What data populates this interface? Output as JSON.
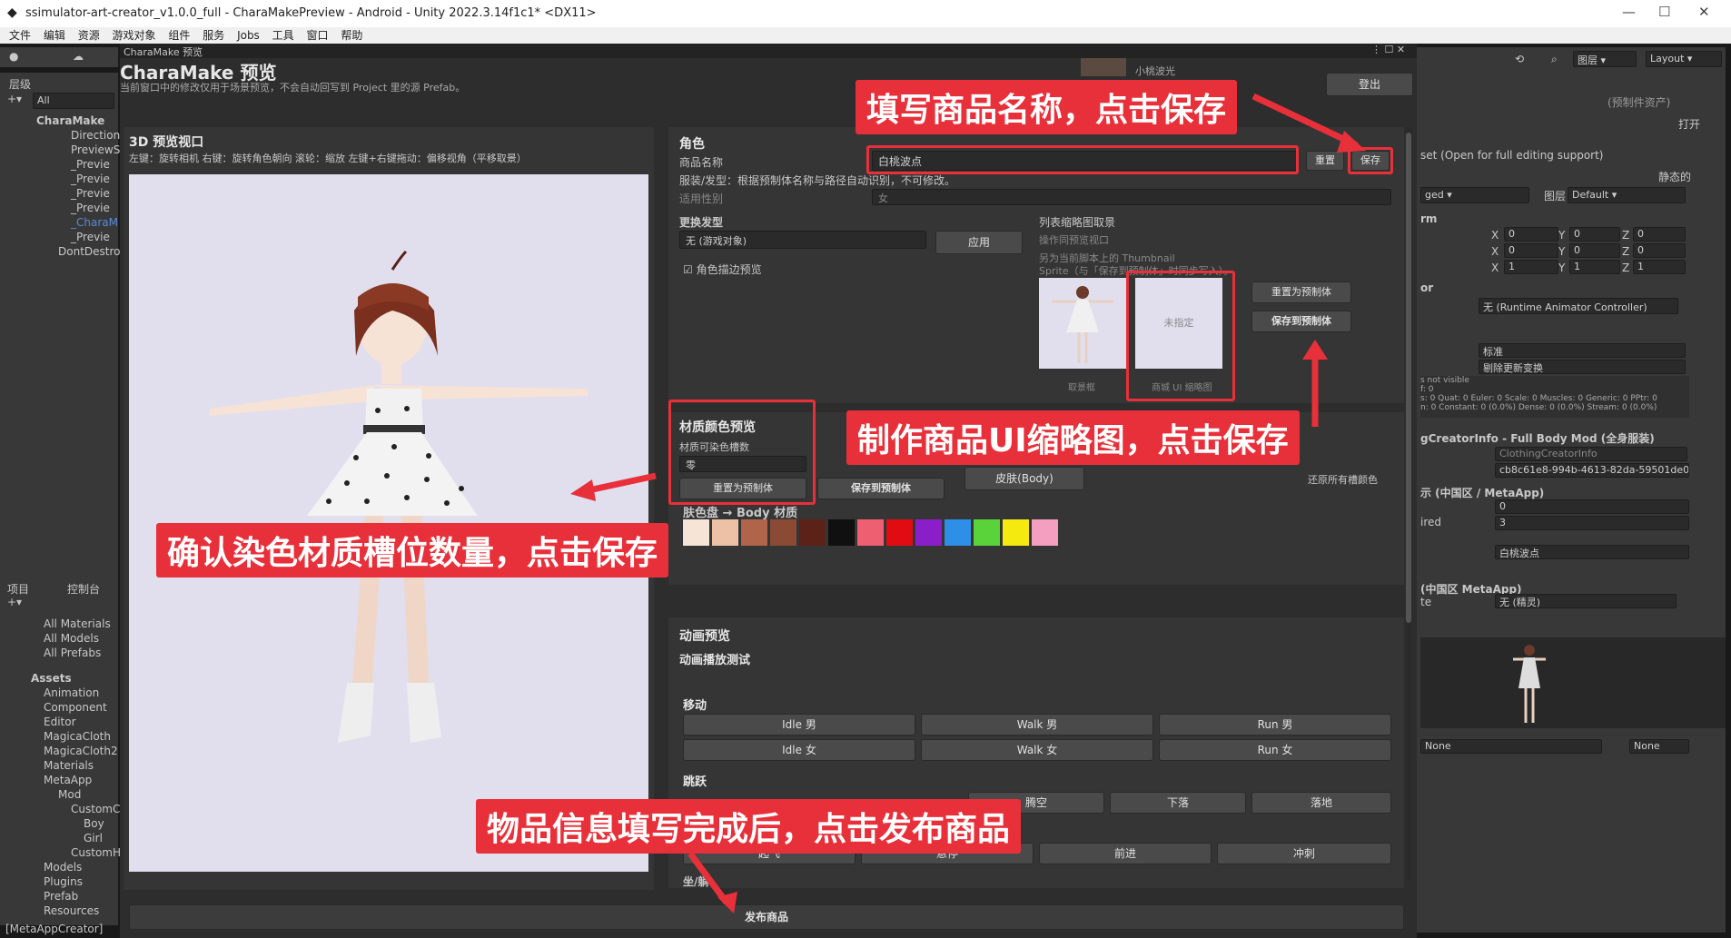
{
  "window": {
    "title": "ssimulator-art-creator_v1.0.0_full - CharaMakePreview - Android - Unity 2022.3.14f1c1* <DX11>"
  },
  "menu": [
    "文件",
    "编辑",
    "资源",
    "游戏对象",
    "组件",
    "服务",
    "Jobs",
    "工具",
    "窗口",
    "帮助"
  ],
  "hierarchy": {
    "tab": "层级",
    "search": "All",
    "items": [
      "CharaMake",
      "Direction",
      "PreviewS",
      "_Previe",
      "_Previe",
      "_Previe",
      "_Previe",
      "_CharaM",
      "_Previe",
      "DontDestro"
    ]
  },
  "project": {
    "tabs": [
      "项目",
      "控制台"
    ],
    "favorites": [
      "All Materials",
      "All Models",
      "All Prefabs"
    ],
    "assets_label": "Assets",
    "folders": [
      "Animation",
      "Component",
      "Editor",
      "MagicaCloth",
      "MagicaCloth2",
      "Materials",
      "MetaApp",
      "Mod",
      "CustomC",
      "Boy",
      "Girl",
      "CustomH",
      "Models",
      "Plugins",
      "Prefab",
      "Resources"
    ],
    "status": "[MetaAppCreator]"
  },
  "modal": {
    "tab": "CharaMake 预览",
    "title": "CharaMake 预览",
    "subtitle": "当前窗口中的修改仅用于场景预览，不会自动回写到 Project 里的源 Prefab。",
    "logout": "登出",
    "user": "小桃波光"
  },
  "viewport": {
    "title": "3D 预览视口",
    "hint": "左键：旋转相机    右键：旋转角色朝向    滚轮：缩放    左键+右键拖动：偏移视角（平移取景）"
  },
  "role": {
    "section": "角色",
    "name_label": "商品名称",
    "name_value": "白桃波点",
    "reset": "重置",
    "save": "保存",
    "desc": "服装/发型：根据预制体名称与路径自动识别，不可修改。",
    "gender_label": "适用性别",
    "gender_value": "女",
    "hair_label": "更换发型",
    "hair_value": "无 (游戏对象)",
    "apply": "应用",
    "outline": "角色描边预览",
    "thumb_title": "列表缩略图取景",
    "thumb_sub": "操作同预览视口",
    "thumb_desc1": "另为当前脚本上的 Thumbnail",
    "thumb_desc2": "Sprite（与「保存到预制体」时同步写入）。",
    "thumb_cap1": "取景框",
    "thumb_cap2": "商城 UI 缩略图",
    "thumb_unset": "未指定",
    "reset_prefab": "重置为预制体",
    "save_prefab": "保存到预制体"
  },
  "material": {
    "section": "材质颜色预览",
    "slots_label": "材质可染色槽数",
    "slots_value": "零",
    "reset_prefab": "重置为预制体",
    "save_prefab": "保存到预制体",
    "skin_tab": "皮肤(Body)",
    "restore": "还原所有槽颜色",
    "palette_label": "肤色盘 → Body 材质",
    "palette": [
      "#f6e4d6",
      "#ecc1a6",
      "#b0644a",
      "#8a4a33",
      "#5c2218",
      "#101010",
      "#ef5f72",
      "#e10b12",
      "#8a1fc9",
      "#2f8ee5",
      "#5ad33a",
      "#f5ea0f",
      "#f59fc0"
    ]
  },
  "anim": {
    "section": "动画预览",
    "sub": "动画播放测试",
    "move": "移动",
    "move_btns": [
      "Idle 男",
      "Walk 男",
      "Run 男",
      "Idle 女",
      "Walk 女",
      "Run 女"
    ],
    "jump": "跳跃",
    "jump_btns": [
      "腾空",
      "下落",
      "落地"
    ],
    "fly_btns": [
      "起飞",
      "悬停",
      "前进",
      "冲刺"
    ],
    "more": "坐/躺"
  },
  "publish": "发布商品",
  "inspector": {
    "layout": "Layout",
    "layers": "图层",
    "prefab_asset": "(预制件资产)",
    "open": "打开",
    "open_note": "set (Open for full editing support)",
    "static": "静态的",
    "tag": "ged",
    "layer_label": "图层",
    "layer_value": "Default",
    "transform": "rm",
    "xyz": [
      [
        "0",
        "0",
        "0"
      ],
      [
        "0",
        "0",
        "0"
      ],
      [
        "1",
        "1",
        "1"
      ]
    ],
    "animator": "or",
    "controller": "无 (Runtime Animator Controller)",
    "cull1": "标准",
    "cull2": "剔除更新变换",
    "clip_info": "s not visible\nf: 0\ns: 0 Quat: 0 Euler: 0 Scale: 0 Muscles: 0 Generic: 0 PPtr: 0\nn: 0 Constant: 0 (0.0%) Dense: 0 (0.0%) Stream: 0 (0.0%)",
    "creator": "gCreatorInfo - Full Body Mod (全身服装)",
    "script": "ClothingCreatorInfo",
    "guid": "cb8c61e8-994b-4613-82da-59501de0e54",
    "cn_header": "示 (中国区 / MetaApp)",
    "val0": "0",
    "req_label": "ired",
    "val3": "3",
    "name_val": "白桃波点",
    "cn2": "(中国区 MetaApp)",
    "sprite_label": "te",
    "sprite_val": "无 (精灵)",
    "none1": "None",
    "none2": "None"
  },
  "callouts": {
    "c1": "填写商品名称，点击保存",
    "c2": "制作商品UI缩略图，点击保存",
    "c3": "确认染色材质槽位数量，点击保存",
    "c4": "物品信息填写完成后，点击发布商品"
  }
}
